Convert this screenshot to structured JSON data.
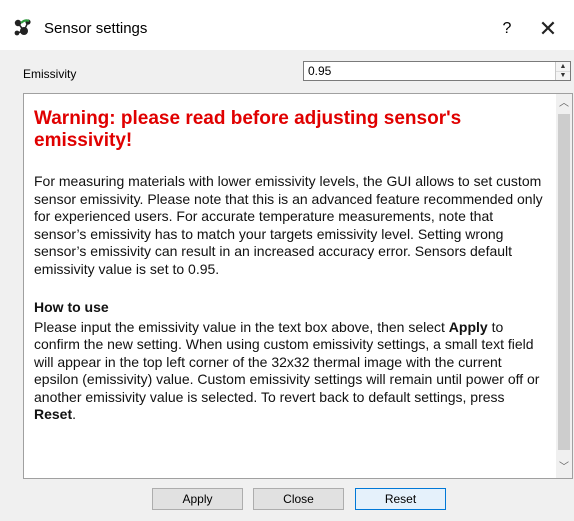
{
  "window": {
    "title": "Sensor settings",
    "help_label": "?",
    "close_label": "✕"
  },
  "emissivity": {
    "label": "Emissivity",
    "value": "0.95"
  },
  "info": {
    "warning": "Warning: please read before adjusting sensor's emissivity!",
    "paragraph": "For measuring materials with lower emissivity levels, the GUI allows to set custom sensor emissivity. Please note that this is an advanced feature recommended only for experienced users. For accurate temperature measurements, note that sensor’s emissivity has to match your targets emissivity level. Setting wrong sensor’s emissivity can result in an increased accuracy error. Sensors default emissivity value is set to 0.95.",
    "howto_title": "How to use",
    "howto_part1": "Please input the emissivity value in the text box above, then select ",
    "howto_apply": "Apply",
    "howto_part2": " to confirm the new setting. When using custom emissivity settings, a small text field will appear in the top left corner of the 32x32 thermal image with the current epsilon (emissivity) value. Custom emissivity settings will remain until power off or another emissivity value is selected. To revert back to default settings, press ",
    "howto_reset": "Reset",
    "howto_end": "."
  },
  "buttons": {
    "apply": "Apply",
    "close": "Close",
    "reset": "Reset"
  },
  "colors": {
    "warning": "#e00000",
    "dialog_bg": "#f0f0f0",
    "focus_border": "#0078d7"
  }
}
